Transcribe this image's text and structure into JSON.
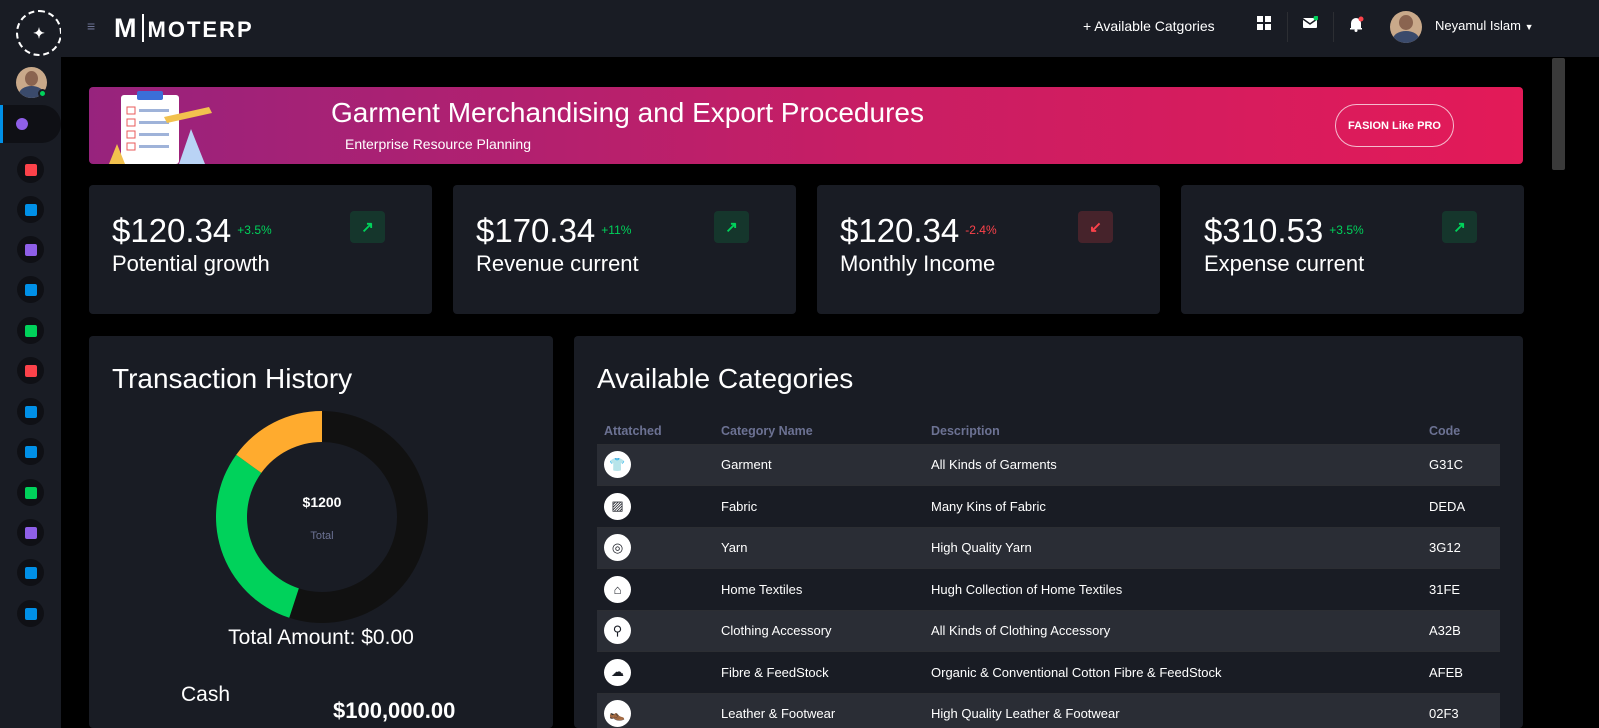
{
  "app": {
    "brand": "MOTERP",
    "logo_text": "MOTERP"
  },
  "topbar": {
    "add_link": "+ Available Catgories",
    "user_name": "Neyamul Islam",
    "accent_color": "#0090e7"
  },
  "sidebar": {
    "items": [
      {
        "icon": "speedometer-icon",
        "color": "#8f5fe8"
      },
      {
        "icon": "list-icon",
        "color": "#fc424a"
      },
      {
        "icon": "layers-icon",
        "color": "#0090e7"
      },
      {
        "icon": "format-list-icon",
        "color": "#8f5fe8"
      },
      {
        "icon": "copy-icon",
        "color": "#0090e7"
      },
      {
        "icon": "stack-icon",
        "color": "#00d25b"
      },
      {
        "icon": "chart-icon",
        "color": "#fc424a"
      },
      {
        "icon": "card-icon",
        "color": "#0090e7"
      },
      {
        "icon": "wind-icon",
        "color": "#0090e7"
      },
      {
        "icon": "globe-icon",
        "color": "#00d25b"
      },
      {
        "icon": "factory-icon",
        "color": "#8f5fe8"
      },
      {
        "icon": "check-icon",
        "color": "#0090e7"
      },
      {
        "icon": "server-icon",
        "color": "#0090e7"
      }
    ]
  },
  "banner": {
    "title": "Garment Merchandising and Export Procedures",
    "subtitle": "Enterprise Resource Planning",
    "button_label": "FASION Like PRO"
  },
  "stats": [
    {
      "value": "$120.34",
      "change": "+3.5%",
      "label": "Potential growth",
      "trend": "up"
    },
    {
      "value": "$170.34",
      "change": "+11%",
      "label": "Revenue current",
      "trend": "up"
    },
    {
      "value": "$120.34",
      "change": "-2.4%",
      "label": "Monthly Income",
      "trend": "down"
    },
    {
      "value": "$310.53",
      "change": "+3.5%",
      "label": "Expense current",
      "trend": "up"
    }
  ],
  "transaction": {
    "title": "Transaction History",
    "donut_total": "$1200",
    "donut_sub": "Total",
    "total_amount": "Total Amount: $0.00",
    "cash_label": "Cash",
    "cash_value": "$100,000.00"
  },
  "chart_data": {
    "type": "pie",
    "categories": [
      "Orange",
      "Green",
      "Dark"
    ],
    "values": [
      15,
      30,
      55
    ],
    "colors": [
      "#ffab2e",
      "#00d25b",
      "#111111"
    ]
  },
  "categories": {
    "title": "Available Categories",
    "headers": [
      "Attatched",
      "Category Name",
      "Description",
      "Code"
    ],
    "rows": [
      {
        "icon": "garment-icon",
        "glyph": "👕",
        "name": "Garment",
        "description": "All Kinds of Garments",
        "code": "G31C"
      },
      {
        "icon": "fabric-icon",
        "glyph": "▨",
        "name": "Fabric",
        "description": "Many Kins of Fabric",
        "code": "DEDA"
      },
      {
        "icon": "yarn-icon",
        "glyph": "◎",
        "name": "Yarn",
        "description": "High Quality Yarn",
        "code": "3G12"
      },
      {
        "icon": "home-textiles-icon",
        "glyph": "⌂",
        "name": "Home Textiles",
        "description": "Hugh Collection of Home Textiles",
        "code": "31FE"
      },
      {
        "icon": "accessory-icon",
        "glyph": "⚲",
        "name": "Clothing Accessory",
        "description": "All Kinds of Clothing Accessory",
        "code": "A32B"
      },
      {
        "icon": "fibre-icon",
        "glyph": "☁",
        "name": "Fibre & FeedStock",
        "description": "Organic & Conventional Cotton Fibre & FeedStock",
        "code": "AFEB"
      },
      {
        "icon": "leather-icon",
        "glyph": "👞",
        "name": "Leather & Footwear",
        "description": "High Quality Leather & Footwear",
        "code": "02F3"
      }
    ]
  }
}
